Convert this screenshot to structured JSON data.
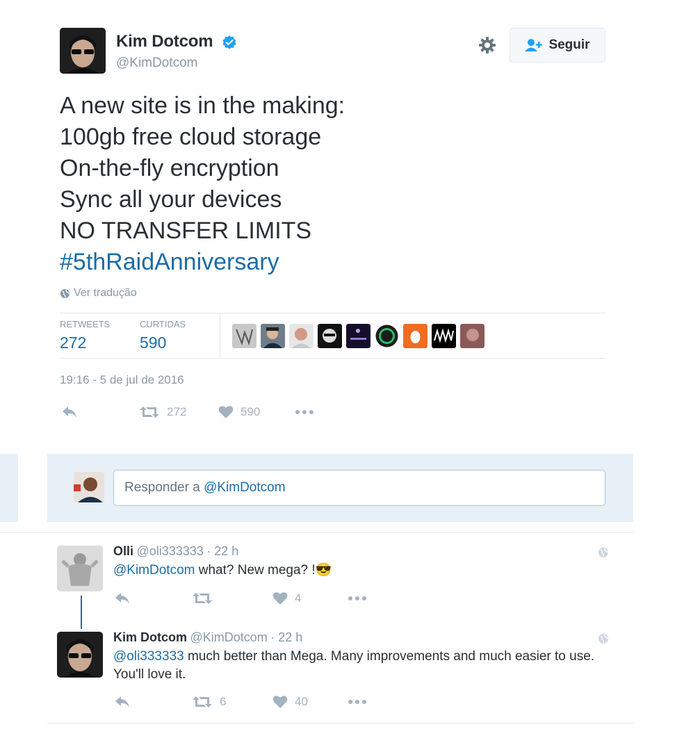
{
  "tweet": {
    "author_name": "Kim Dotcom",
    "author_handle": "@KimDotcom",
    "follow_label": "Seguir",
    "lines": [
      "A new site is in the making:",
      "100gb free cloud storage",
      "On-the-fly encryption",
      "Sync all your devices",
      "NO TRANSFER LIMITS"
    ],
    "hashtag": "#5thRaidAnniversary",
    "translate_label": "Ver tradução",
    "retweets_label": "RETWEETS",
    "retweets_count": "272",
    "likes_label": "CURTIDAS",
    "likes_count": "590",
    "timestamp": "19:16 - 5 de jul de 2016",
    "action_retweets": "272",
    "action_likes": "590"
  },
  "reply_box": {
    "placeholder_prefix": "Responder a ",
    "placeholder_mention": "@KimDotcom"
  },
  "replies": [
    {
      "name": "Olli",
      "handle": "@oli333333",
      "time": "· 22 h",
      "mention": "@KimDotcom",
      "text": " what?  New mega? !",
      "emoji": "😎",
      "retweets": "",
      "likes": "4"
    },
    {
      "name": "Kim Dotcom",
      "handle": "@KimDotcom",
      "time": "· 22 h",
      "mention": "@oli333333",
      "text": " much better than Mega. Many improvements and much easier to use. You'll love it.",
      "retweets": "6",
      "likes": "40"
    }
  ],
  "colors": {
    "link": "#1b6ca8",
    "muted": "#8899a6",
    "icon": "#a3b2bf",
    "reply_panel": "#e8f0f7"
  }
}
